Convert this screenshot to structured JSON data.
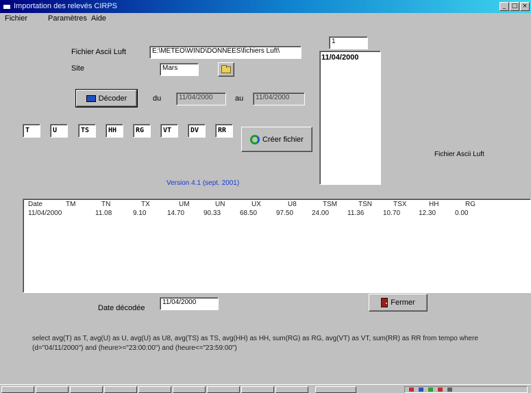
{
  "window": {
    "title": "Importation des relevés CIRPS",
    "btn_min": "_",
    "btn_max": "□",
    "btn_close": "×"
  },
  "menu": [
    "Fichier",
    "Paramètres",
    "Aide"
  ],
  "form": {
    "ascii_label": "Fichier Ascii Luft",
    "ascii_value": "E:\\METEO\\WIND\\DONNEES\\fichiers Luft\\",
    "site_label": "Site",
    "site_value": "Mars",
    "decode_button": "Décoder",
    "du_label": "du",
    "du_value": "11/04/2000",
    "au_label": "au",
    "au_value": "11/04/2000",
    "count_value": "1",
    "codes": [
      "T",
      "U",
      "TS",
      "HH",
      "RG",
      "VT",
      "DV",
      "RR"
    ],
    "create_button": "Créer fichier",
    "ascii_luft_label": "Fichier Ascii Luft",
    "version": "Version 4.1   (sept. 2001)"
  },
  "date_list": [
    "11/04/2000"
  ],
  "table": {
    "headers": [
      "Date",
      "TM",
      "TN",
      "TX",
      "UM",
      "UN",
      "UX",
      "U8",
      "TSM",
      "TSN",
      "TSX",
      "HH",
      "RG"
    ],
    "rows": [
      [
        "11/04/2000",
        "",
        "11.08",
        "9.10",
        "14.70",
        "90.33",
        "68.50",
        "97.50",
        "24.00",
        "11.36",
        "10.70",
        "12.30",
        "0.00"
      ]
    ]
  },
  "decoded": {
    "label": "Date décodée",
    "value": "11/04/2000"
  },
  "close_button": "Fermer",
  "sql_text": "select  avg(T) as T, avg(U) as U, avg(U) as U8, avg(TS) as TS, avg(HH) as HH, sum(RG) as RG, avg(VT) as VT, sum(RR) as RR from tempo  where (d=\"04/11/2000\") and (heure>=\"23:00:00\") and (heure<=\"23:59:00\")"
}
